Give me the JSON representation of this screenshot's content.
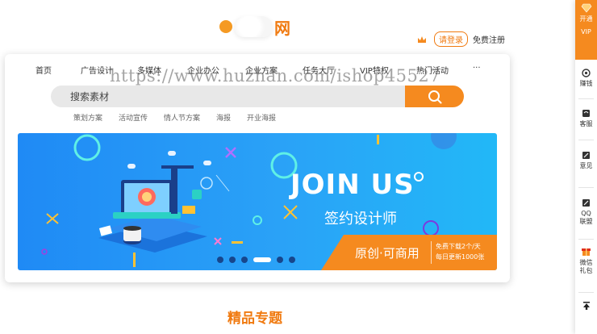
{
  "header": {
    "logo_text": "网",
    "login_label": "请登录",
    "register_label": "免费注册"
  },
  "nav": {
    "items": [
      "首页",
      "广告设计",
      "多媒体",
      "企业办公",
      "企业方案",
      "任务大厅",
      "VIP特权",
      "热门活动",
      "···"
    ]
  },
  "search": {
    "placeholder": "搜索素材"
  },
  "tags": [
    "策划方案",
    "活动宣传",
    "情人节方案",
    "海报",
    "开业海报"
  ],
  "banner": {
    "title": "JOIN US",
    "subtitle": "签约设计师",
    "strip_main": "原创·可商用",
    "strip_line1": "免费下载2个/天",
    "strip_line2": "每日更新1000张",
    "slide_count": 6,
    "active_slide": 4
  },
  "section": {
    "title": "精品专题"
  },
  "sidebar": {
    "vip_line1": "开通",
    "vip_line2": "VIP",
    "items": [
      {
        "label": "赚钱",
        "icon": "coin-icon"
      },
      {
        "label": "客服",
        "icon": "headset-icon"
      },
      {
        "label": "意见",
        "icon": "edit-icon"
      },
      {
        "label": "QQ",
        "label2": "联盟",
        "icon": "qq-icon"
      },
      {
        "label": "微信",
        "label2": "礼包",
        "icon": "gift-icon"
      }
    ]
  },
  "watermark": "https://www.huzhan.com/ishop45527",
  "colors": {
    "accent": "#f58a1f",
    "banner_blue": "#1f8af5"
  }
}
